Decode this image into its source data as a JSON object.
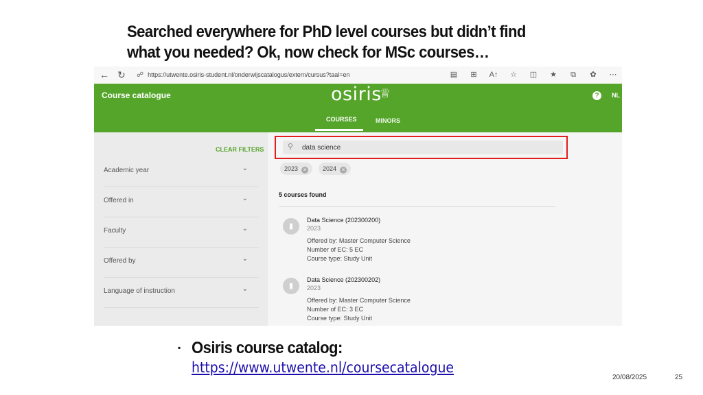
{
  "slide": {
    "title_line1": "Searched everywhere for PhD level courses but didn’t find",
    "title_line2": "what you needed? Ok, now check for MSc courses…",
    "bullet_title": "Osiris course catalog:",
    "bullet_link": "https://www.utwente.nl/coursecatalogue",
    "footer_date": "20/08/2025",
    "footer_page": "25"
  },
  "browser": {
    "url": "https://utwente.osiris-student.nl/onderwijscatalogus/extern/cursus?taal=en",
    "icons": [
      "reader-icon",
      "grid-icon",
      "text-size-icon",
      "favorite-icon",
      "split-icon",
      "favorites-icon",
      "collections-icon",
      "copilot-icon",
      "more-icon"
    ]
  },
  "app": {
    "title": "Course catalogue",
    "logo": "osiris",
    "lang": "NL",
    "help": "?",
    "tabs": [
      {
        "label": "COURSES",
        "active": true
      },
      {
        "label": "MINORS",
        "active": false
      }
    ],
    "accent_color": "#55a52a"
  },
  "sidebar": {
    "clear_filters": "CLEAR FILTERS",
    "filters": [
      "Academic year",
      "Offered in",
      "Faculty",
      "Offered by",
      "Language of instruction"
    ]
  },
  "search": {
    "value": "data science",
    "highlight_color": "#e21b1b"
  },
  "chips": [
    "2023",
    "2024"
  ],
  "results": {
    "count_label": "5 courses found",
    "courses": [
      {
        "title": "Data Science (202300200)",
        "year": "2023",
        "offered_by": "Offered by: Master Computer Science",
        "ec": "Number of EC: 5 EC",
        "type": "Course type: Study Unit"
      },
      {
        "title": "Data Science (202300202)",
        "year": "2023",
        "offered_by": "Offered by: Master Computer Science",
        "ec": "Number of EC: 3 EC",
        "type": "Course type: Study Unit"
      }
    ]
  }
}
